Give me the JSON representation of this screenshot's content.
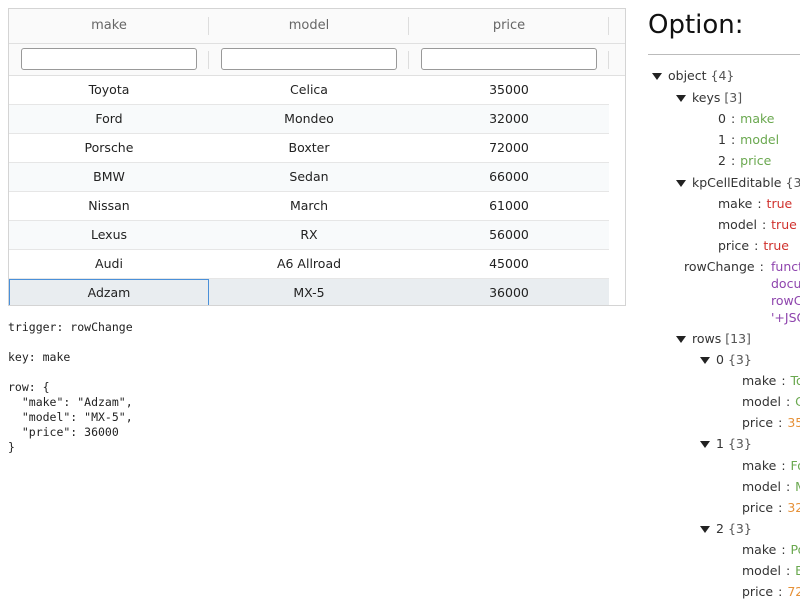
{
  "grid": {
    "columns": [
      "make",
      "model",
      "price"
    ],
    "filters": [
      "",
      "",
      ""
    ],
    "rows": [
      [
        "Toyota",
        "Celica",
        "35000"
      ],
      [
        "Ford",
        "Mondeo",
        "32000"
      ],
      [
        "Porsche",
        "Boxter",
        "72000"
      ],
      [
        "BMW",
        "Sedan",
        "66000"
      ],
      [
        "Nissan",
        "March",
        "61000"
      ],
      [
        "Lexus",
        "RX",
        "56000"
      ],
      [
        "Audi",
        "A6 Allroad",
        "45000"
      ],
      [
        "Adzam",
        "MX-5",
        "36000"
      ]
    ]
  },
  "log": {
    "lines": [
      "trigger: rowChange",
      "",
      "key: make",
      "",
      "row: {",
      "  \"make\": \"Adzam\",",
      "  \"model\": \"MX-5\",",
      "  \"price\": 36000",
      "}"
    ]
  },
  "options": {
    "title": "Option:",
    "tree": {
      "root": {
        "key": "object",
        "count": "{4}"
      },
      "keys": {
        "key": "keys",
        "count": "[3]",
        "items": [
          {
            "k": "0",
            "v": "make"
          },
          {
            "k": "1",
            "v": "model"
          },
          {
            "k": "2",
            "v": "price"
          }
        ]
      },
      "kpCellEditable": {
        "key": "kpCellEditable",
        "count": "{3}",
        "items": [
          {
            "k": "make",
            "v": "true"
          },
          {
            "k": "model",
            "v": "true"
          },
          {
            "k": "price",
            "v": "true"
          }
        ]
      },
      "rowChange": {
        "key": "rowChange",
        "lines": [
          "funct",
          "docu",
          "rowC",
          "'+JSO"
        ]
      },
      "rows": {
        "key": "rows",
        "count": "[13]",
        "items": [
          {
            "k": "0",
            "count": "{3}",
            "fields": [
              {
                "k": "make",
                "v": "To"
              },
              {
                "k": "model",
                "v": "C"
              },
              {
                "k": "price",
                "v": "35"
              }
            ]
          },
          {
            "k": "1",
            "count": "{3}",
            "fields": [
              {
                "k": "make",
                "v": "Fo"
              },
              {
                "k": "model",
                "v": "M"
              },
              {
                "k": "price",
                "v": "32"
              }
            ]
          },
          {
            "k": "2",
            "count": "{3}",
            "fields": [
              {
                "k": "make",
                "v": "Po"
              },
              {
                "k": "model",
                "v": "B"
              },
              {
                "k": "price",
                "v": "72"
              }
            ]
          }
        ]
      }
    }
  }
}
